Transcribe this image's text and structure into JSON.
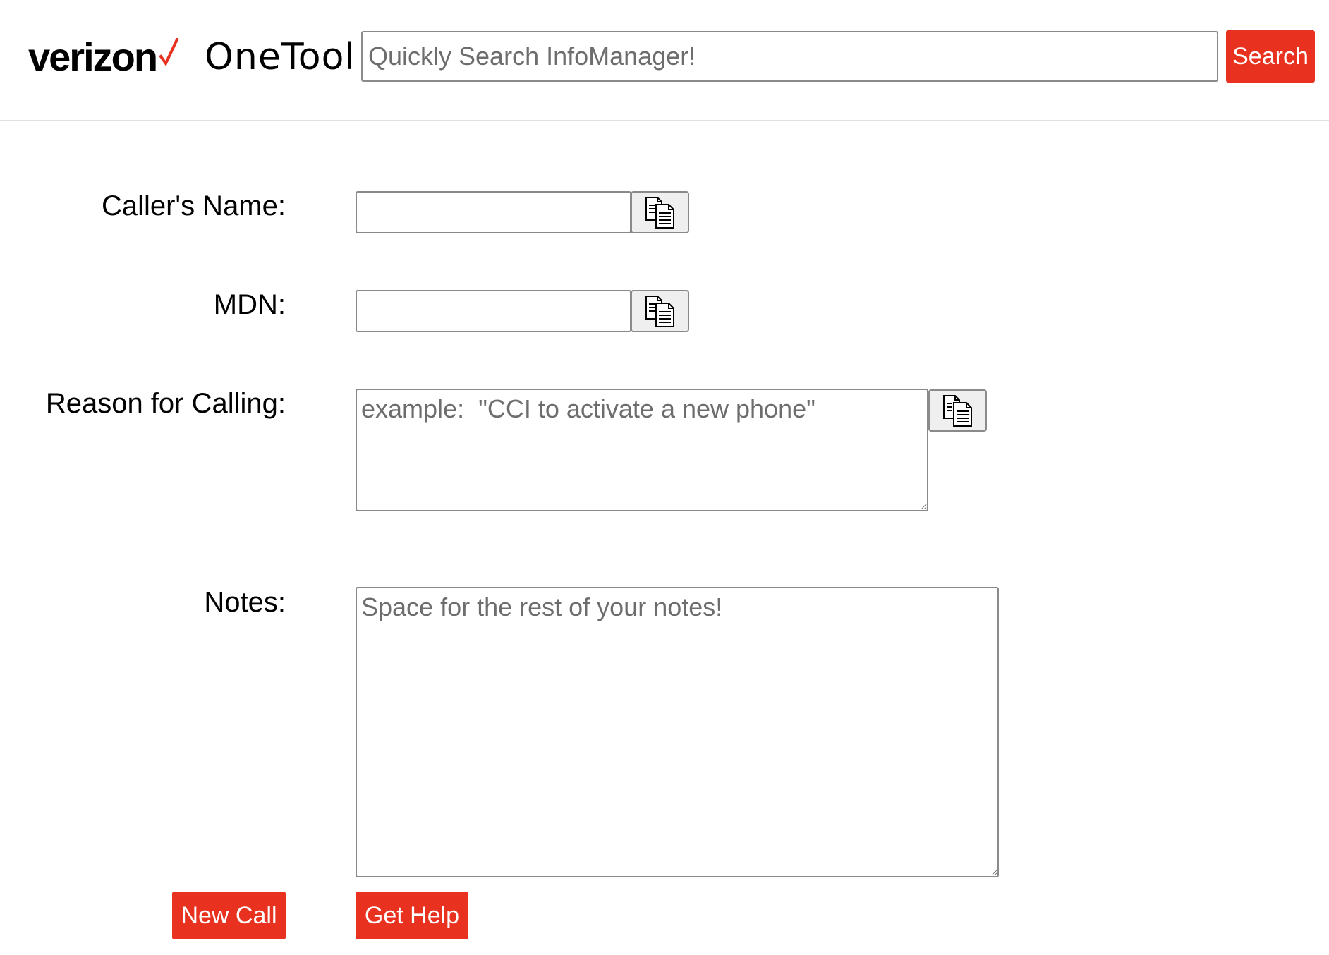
{
  "header": {
    "logo_text": "verizon",
    "app_name": "OneTool",
    "search_placeholder": "Quickly Search InfoManager!",
    "search_value": "",
    "search_button_label": "Search"
  },
  "form": {
    "callers_name": {
      "label": "Caller's Name:",
      "value": ""
    },
    "mdn": {
      "label": "MDN:",
      "value": ""
    },
    "reason": {
      "label": "Reason for Calling:",
      "placeholder": "example:  \"CCI to activate a new phone\"",
      "value": ""
    },
    "notes": {
      "label": "Notes:",
      "placeholder": "Space for the rest of your notes!",
      "value": ""
    }
  },
  "actions": {
    "new_call_label": "New Call",
    "get_help_label": "Get Help"
  },
  "icons": {
    "copy": "copy-icon",
    "brand_check": "check-icon"
  },
  "colors": {
    "accent": "#e8321f",
    "brand_check": "#e8321f"
  }
}
